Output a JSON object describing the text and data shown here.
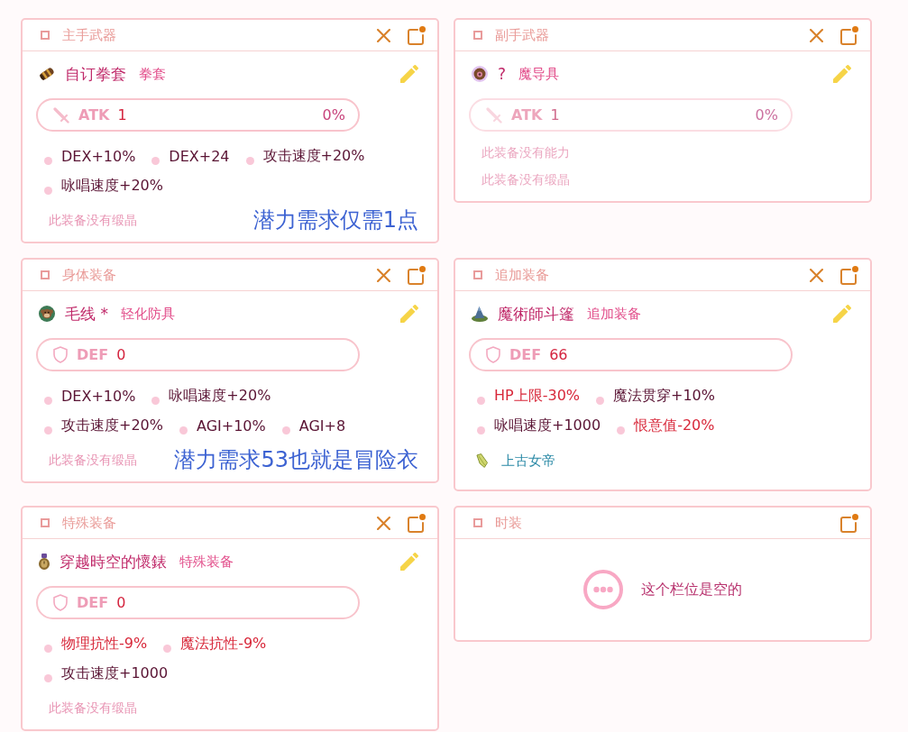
{
  "slots": [
    {
      "kind": "equipped",
      "title": "主手武器",
      "removable": true,
      "item": {
        "name": "自订拳套",
        "type": "拳套"
      },
      "stat": {
        "kind": "weapon",
        "label": "ATK",
        "value": "1",
        "percent": "0%"
      },
      "dimmed": false,
      "abilities": [
        {
          "text": "DEX+10%",
          "negative": false
        },
        {
          "text": "DEX+24",
          "negative": false
        },
        {
          "text": "攻击速度+20%",
          "negative": false
        },
        {
          "text": "咏唱速度+20%",
          "negative": false
        }
      ],
      "crystals_note": "此装备没有缎晶",
      "annotation": "潜力需求仅需1点"
    },
    {
      "kind": "equipped",
      "title": "副手武器",
      "removable": true,
      "item": {
        "name": "?",
        "type": "魔导具"
      },
      "stat": {
        "kind": "weapon",
        "label": "ATK",
        "value": "1",
        "percent": "0%"
      },
      "dimmed": true,
      "abilities_note": "此装备没有能力",
      "crystals_note": "此装备没有缎晶"
    },
    {
      "kind": "equipped",
      "title": "身体装备",
      "removable": true,
      "item": {
        "name": "毛线 *",
        "type": "轻化防具"
      },
      "stat": {
        "kind": "armor",
        "label": "DEF",
        "value": "0"
      },
      "dimmed": false,
      "abilities": [
        {
          "text": "DEX+10%",
          "negative": false
        },
        {
          "text": "咏唱速度+20%",
          "negative": false
        },
        {
          "text": "攻击速度+20%",
          "negative": false
        },
        {
          "text": "AGI+10%",
          "negative": false
        },
        {
          "text": "AGI+8",
          "negative": false
        }
      ],
      "crystals_note": "此装备没有缎晶",
      "annotation": "潜力需求53也就是冒险衣"
    },
    {
      "kind": "equipped",
      "title": "追加装备",
      "removable": true,
      "item": {
        "name": "魔術師斗篷",
        "type": "追加装备"
      },
      "stat": {
        "kind": "armor",
        "label": "DEF",
        "value": "66"
      },
      "dimmed": false,
      "abilities": [
        {
          "text": "HP上限-30%",
          "negative": true
        },
        {
          "text": "魔法贯穿+10%",
          "negative": false
        },
        {
          "text": "咏唱速度+1000",
          "negative": false
        },
        {
          "text": "恨意值-20%",
          "negative": true
        }
      ],
      "crystals": [
        {
          "name": "上古女帝"
        }
      ]
    },
    {
      "kind": "equipped",
      "title": "特殊装备",
      "removable": true,
      "item": {
        "name": "穿越時空的懷錶",
        "type": "特殊装备"
      },
      "stat": {
        "kind": "armor",
        "label": "DEF",
        "value": "0"
      },
      "dimmed": false,
      "abilities": [
        {
          "text": "物理抗性-9%",
          "negative": true
        },
        {
          "text": "魔法抗性-9%",
          "negative": true
        },
        {
          "text": "攻击速度+1000",
          "negative": false
        }
      ],
      "crystals_note": "此装备没有缎晶"
    },
    {
      "kind": "empty",
      "title": "时装",
      "removable": false,
      "message": "这个栏位是空的"
    }
  ]
}
